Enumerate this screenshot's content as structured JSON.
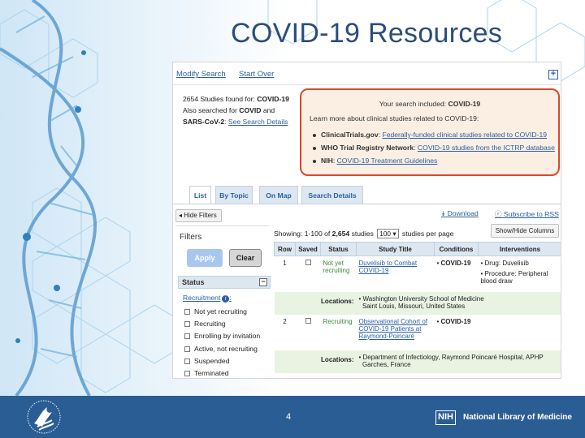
{
  "slide": {
    "title": "COVID-19 Resources",
    "page_number": "4"
  },
  "footer": {
    "nih_badge": "NIH",
    "nlm_label": "National Library of Medicine"
  },
  "topbar": {
    "modify_search": "Modify Search",
    "start_over": "Start Over"
  },
  "found": {
    "count_text": "2654 Studies found for:",
    "term": "COVID-19",
    "also_text": "Also searched for",
    "also_term1": "COVID",
    "and_text": "and",
    "also_term2": "SARS-CoV-2",
    "see_details": "See Search Details"
  },
  "infobox": {
    "included_text": "Your search included:",
    "included_term": "COVID-19",
    "learn_more": "Learn more about clinical studies related to COVID-19:",
    "items": [
      {
        "source": "ClinicalTrials.gov",
        "link": "Federally-funded clinical studies related to COVID-19"
      },
      {
        "source": "WHO Trial Registry Network",
        "link": "COVID-19 studies from the ICTRP database"
      },
      {
        "source": "NIH",
        "link": "COVID-19 Treatment Guidelines"
      }
    ]
  },
  "tabs": [
    "List",
    "By Topic",
    "On Map",
    "Search Details"
  ],
  "toolbar": {
    "hide_filters": "Hide Filters",
    "download": "Download",
    "subscribe": "Subscribe to RSS",
    "show_hide_columns": "Show/Hide Columns"
  },
  "filters": {
    "heading": "Filters",
    "apply": "Apply",
    "clear": "Clear",
    "status_heading": "Status",
    "recruitment_label": "Recruitment",
    "options": [
      "Not yet recruiting",
      "Recruiting",
      "Enrolling by invitation",
      "Active, not recruiting",
      "Suspended",
      "Terminated"
    ]
  },
  "results": {
    "showing_prefix": "Showing: 1-100 of",
    "total": "2,654",
    "studies_word": "studies",
    "per_page_value": "100",
    "per_page_suffix": "studies per page",
    "columns": [
      "Row",
      "Saved",
      "Status",
      "Study Title",
      "Conditions",
      "Interventions"
    ],
    "rows": [
      {
        "row": "1",
        "status": "Not yet recruiting",
        "title": "Duvelisib to Combat COVID-19",
        "condition": "COVID-19",
        "interventions": [
          "Drug: Duvelisib",
          "Procedure: Peripheral blood draw"
        ],
        "locations_label": "Locations:",
        "location_line1": "Washington University School of Medicine",
        "location_line2": "Saint Louis, Missouri, United States"
      },
      {
        "row": "2",
        "status": "Recruiting",
        "title": "Observational Cohort of COVID-19 Patients at Raymond-Poincaré",
        "condition": "COVID-19",
        "interventions": [],
        "locations_label": "Locations:",
        "location_line1": "Department of Infectiology, Raymond Poincaré Hospital, APHP",
        "location_line2": "Garches, France"
      }
    ]
  },
  "colors": {
    "title": "#2c4d7a",
    "link": "#2a5fa6",
    "highlight_border": "#d9482b",
    "footer": "#2a5d93"
  }
}
